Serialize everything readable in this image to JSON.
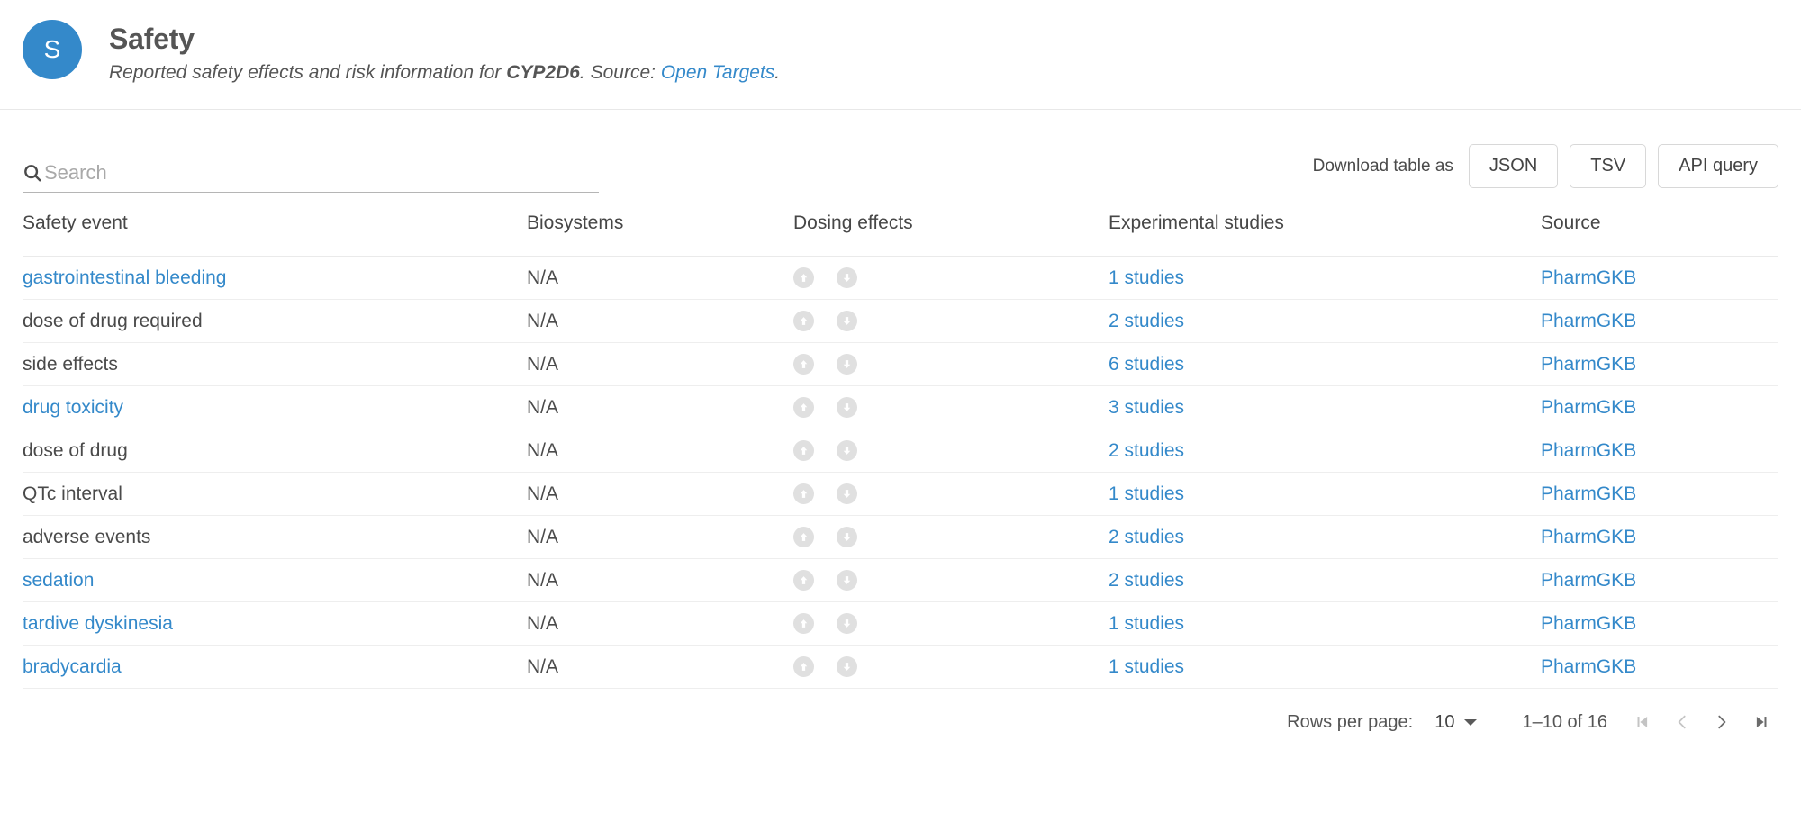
{
  "header": {
    "avatar_letter": "S",
    "title": "Safety",
    "subtitle_prefix": "Reported safety effects and risk information for ",
    "subtitle_gene": "CYP2D6",
    "subtitle_middle": ". Source: ",
    "subtitle_link": "Open Targets",
    "subtitle_suffix": ".",
    "accent_color": "#3489ca"
  },
  "search": {
    "placeholder": "Search",
    "value": "",
    "icon": "search-icon"
  },
  "download": {
    "label": "Download table as",
    "buttons": [
      "JSON",
      "TSV",
      "API query"
    ]
  },
  "table": {
    "columns": [
      "Safety event",
      "Biosystems",
      "Dosing effects",
      "Experimental studies",
      "Source"
    ],
    "rows": [
      {
        "event": "gastrointestinal bleeding",
        "event_is_link": true,
        "biosystems": "N/A",
        "dosing": [
          "arrow-up-icon",
          "arrow-down-icon"
        ],
        "studies": "1 studies",
        "source": "PharmGKB"
      },
      {
        "event": "dose of drug required",
        "event_is_link": false,
        "biosystems": "N/A",
        "dosing": [
          "arrow-up-icon",
          "arrow-down-icon"
        ],
        "studies": "2 studies",
        "source": "PharmGKB"
      },
      {
        "event": "side effects",
        "event_is_link": false,
        "biosystems": "N/A",
        "dosing": [
          "arrow-up-icon",
          "arrow-down-icon"
        ],
        "studies": "6 studies",
        "source": "PharmGKB"
      },
      {
        "event": "drug toxicity",
        "event_is_link": true,
        "biosystems": "N/A",
        "dosing": [
          "arrow-up-icon",
          "arrow-down-icon"
        ],
        "studies": "3 studies",
        "source": "PharmGKB"
      },
      {
        "event": "dose of drug",
        "event_is_link": false,
        "biosystems": "N/A",
        "dosing": [
          "arrow-up-icon",
          "arrow-down-icon"
        ],
        "studies": "2 studies",
        "source": "PharmGKB"
      },
      {
        "event": "QTc interval",
        "event_is_link": false,
        "biosystems": "N/A",
        "dosing": [
          "arrow-up-icon",
          "arrow-down-icon"
        ],
        "studies": "1 studies",
        "source": "PharmGKB"
      },
      {
        "event": "adverse events",
        "event_is_link": false,
        "biosystems": "N/A",
        "dosing": [
          "arrow-up-icon",
          "arrow-down-icon"
        ],
        "studies": "2 studies",
        "source": "PharmGKB"
      },
      {
        "event": "sedation",
        "event_is_link": true,
        "biosystems": "N/A",
        "dosing": [
          "arrow-up-icon",
          "arrow-down-icon"
        ],
        "studies": "2 studies",
        "source": "PharmGKB"
      },
      {
        "event": "tardive dyskinesia",
        "event_is_link": true,
        "biosystems": "N/A",
        "dosing": [
          "arrow-up-icon",
          "arrow-down-icon"
        ],
        "studies": "1 studies",
        "source": "PharmGKB"
      },
      {
        "event": "bradycardia",
        "event_is_link": true,
        "biosystems": "N/A",
        "dosing": [
          "arrow-up-icon",
          "arrow-down-icon"
        ],
        "studies": "1 studies",
        "source": "PharmGKB"
      }
    ]
  },
  "pagination": {
    "rows_per_page_label": "Rows per page:",
    "rows_per_page_value": "10",
    "range_label": "1–10 of 16",
    "first_enabled": false,
    "prev_enabled": false,
    "next_enabled": true,
    "last_enabled": true
  },
  "colors": {
    "link": "#3489ca",
    "text": "#4a4a4a",
    "border": "#eeeeee",
    "badge": "#e0e0e0"
  }
}
